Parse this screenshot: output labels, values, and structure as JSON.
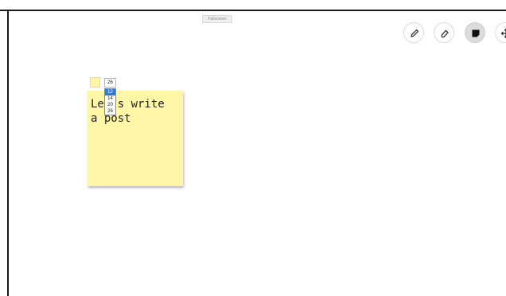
{
  "toolbar": {
    "fullscreen_label": "Fullscreen",
    "tools": [
      {
        "icon": "pencil-icon"
      },
      {
        "icon": "eraser-icon"
      },
      {
        "icon": "sticky-note-icon",
        "active": true
      },
      {
        "icon": "move-icon"
      }
    ]
  },
  "note": {
    "color": "#fff6a8",
    "text": "Let's write\na post",
    "font_size_selected": "26",
    "font_size_options": [
      "12",
      "14",
      "20",
      "26"
    ],
    "highlighted_option": "12"
  }
}
